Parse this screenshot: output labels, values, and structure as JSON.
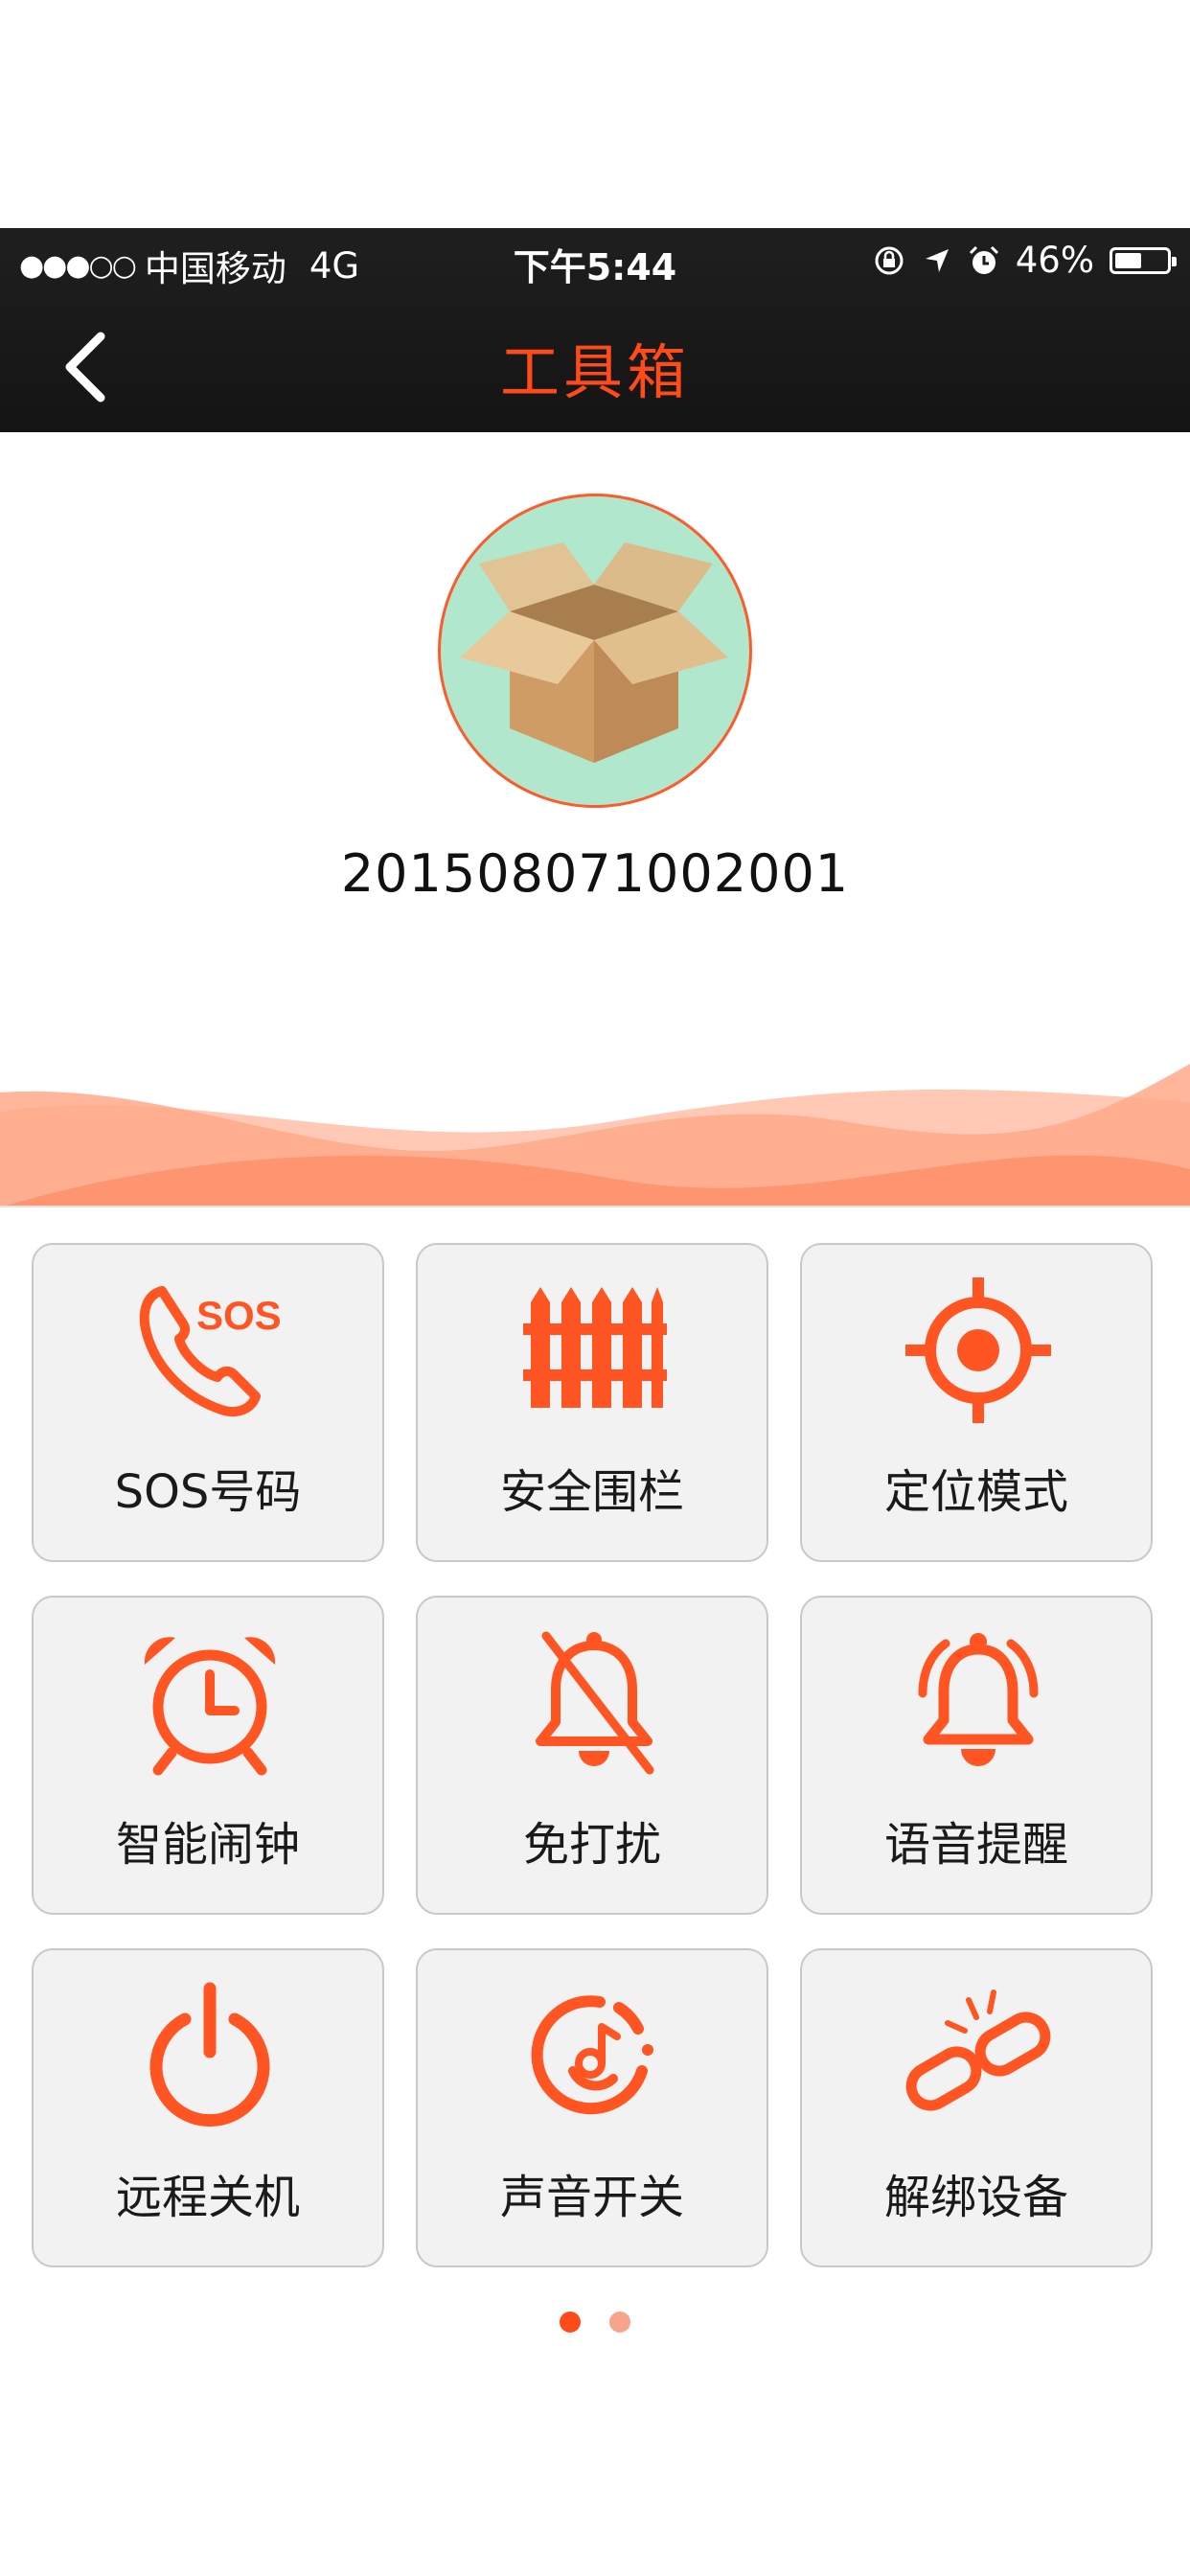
{
  "status_bar": {
    "signal": "●●●○○",
    "carrier": "中国移动",
    "network": "4G",
    "time": "下午5:44",
    "battery": "46%",
    "battery_level": 0.46
  },
  "nav": {
    "title": "工具箱",
    "back_icon": "chevron-left-icon"
  },
  "device": {
    "id": "201508071002001",
    "avatar_icon": "cardboard-box-icon"
  },
  "colors": {
    "accent": "#ff4a1a",
    "header_bg": "#1a1a1a",
    "avatar_bg": "#b0e7cd",
    "tile_bg": "#f2f2f2"
  },
  "tools": [
    {
      "label": "SOS号码",
      "icon": "sos-phone-icon"
    },
    {
      "label": "安全围栏",
      "icon": "fence-icon"
    },
    {
      "label": "定位模式",
      "icon": "locate-target-icon"
    },
    {
      "label": "智能闹钟",
      "icon": "alarm-clock-icon"
    },
    {
      "label": "免打扰",
      "icon": "bell-off-icon"
    },
    {
      "label": "语音提醒",
      "icon": "bell-ring-icon"
    },
    {
      "label": "远程关机",
      "icon": "power-icon"
    },
    {
      "label": "声音开关",
      "icon": "music-disc-icon"
    },
    {
      "label": "解绑设备",
      "icon": "broken-link-icon"
    }
  ],
  "pager": {
    "pages": 2,
    "current": 1
  }
}
